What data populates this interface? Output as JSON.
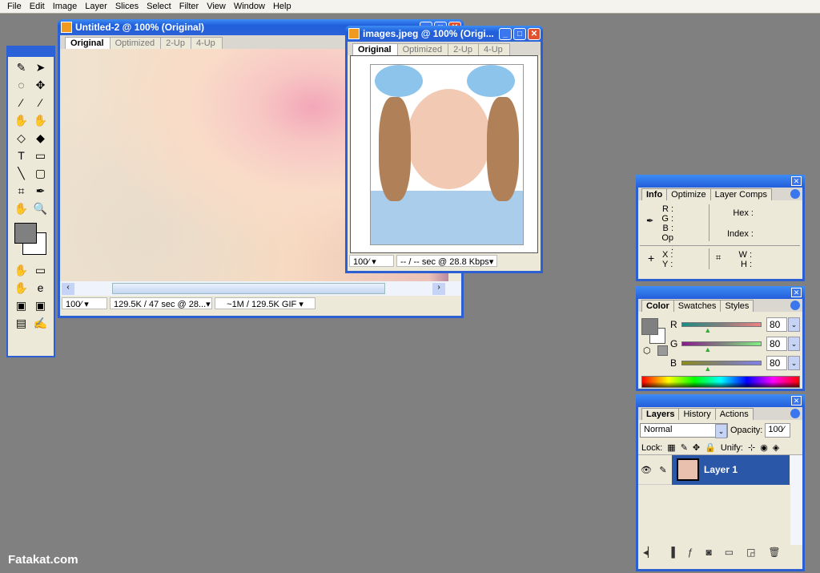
{
  "menu": [
    "File",
    "Edit",
    "Image",
    "Layer",
    "Slices",
    "Select",
    "Filter",
    "View",
    "Window",
    "Help"
  ],
  "toolbox": {
    "tools": [
      "✎",
      "➤",
      "◌",
      "✥",
      "⁄",
      "⁄",
      "✋",
      "✋",
      "◇",
      "◆",
      "T",
      "▭",
      "╲",
      "▢",
      "⌗",
      "✒",
      "✋",
      "🔍"
    ],
    "bottom": [
      "✋",
      "▭",
      "✋",
      "e",
      "▣",
      "▣",
      "▤",
      "✍"
    ]
  },
  "doc1": {
    "title": "Untitled-2 @ 100% (Original)",
    "tabs": [
      "Original",
      "Optimized",
      "2-Up",
      "4-Up"
    ],
    "zoom": "100⁄",
    "info1": "129.5K / 47 sec @ 28...",
    "info2": "~1M / 129.5K GIF"
  },
  "doc2": {
    "title": "images.jpeg @ 100% (Origi...",
    "tabs": [
      "Original",
      "Optimized",
      "2-Up",
      "4-Up"
    ],
    "zoom": "100⁄",
    "info1": "-- / -- sec @ 28.8 Kbps"
  },
  "info": {
    "tabs": [
      "Info",
      "Optimize",
      "Layer Comps"
    ],
    "r": "R :",
    "g": "G :",
    "b": "B :",
    "op": "Op :",
    "hex": "Hex :",
    "index": "Index :",
    "x": "X :",
    "y": "Y :",
    "w": "W :",
    "h": "H :"
  },
  "color": {
    "tabs": [
      "Color",
      "Swatches",
      "Styles"
    ],
    "channels": [
      {
        "label": "R",
        "value": "80"
      },
      {
        "label": "G",
        "value": "80"
      },
      {
        "label": "B",
        "value": "80"
      }
    ],
    "foreground": "#808080"
  },
  "layers": {
    "tabs": [
      "Layers",
      "History",
      "Actions"
    ],
    "blend": "Normal",
    "opacity_label": "Opacity:",
    "opacity": "100⁄",
    "lock_label": "Lock:",
    "unify_label": "Unify:",
    "items": [
      {
        "name": "Layer 1",
        "selected": true
      }
    ]
  },
  "watermark": "Fatakat.com"
}
